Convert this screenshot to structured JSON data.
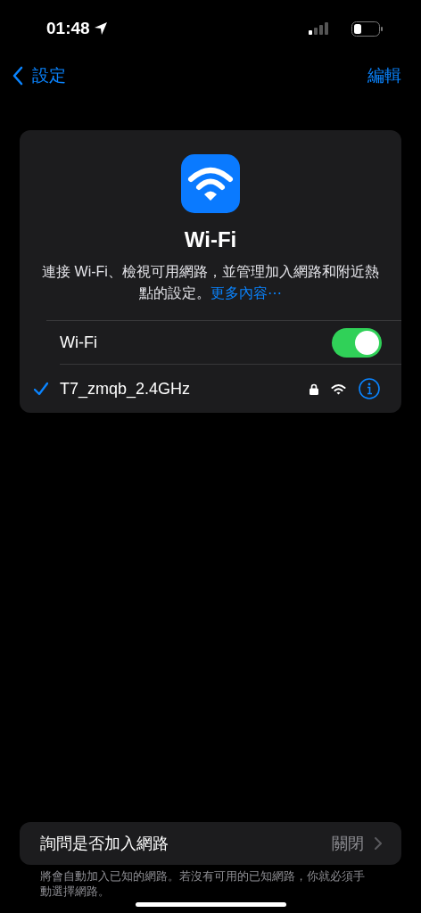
{
  "status_bar": {
    "time": "01:48"
  },
  "nav": {
    "back": "設定",
    "action": "編輯"
  },
  "wifi_card": {
    "title": "Wi-Fi",
    "description": "連接 Wi-Fi、檢視可用網路，並管理加入網路和附近熱點的設定。",
    "link": "更多內容⋯",
    "toggle": {
      "label": "Wi-Fi",
      "on": true
    },
    "networks": [
      {
        "name": "T7_zmqb_2.4GHz",
        "selected": true,
        "locked": true
      }
    ]
  },
  "ask_to_join": {
    "label": "詢問是否加入網路",
    "value": "關閉",
    "footnote": "將會自動加入已知的網路。若沒有可用的已知網路，你就必須手動選擇網路。"
  }
}
